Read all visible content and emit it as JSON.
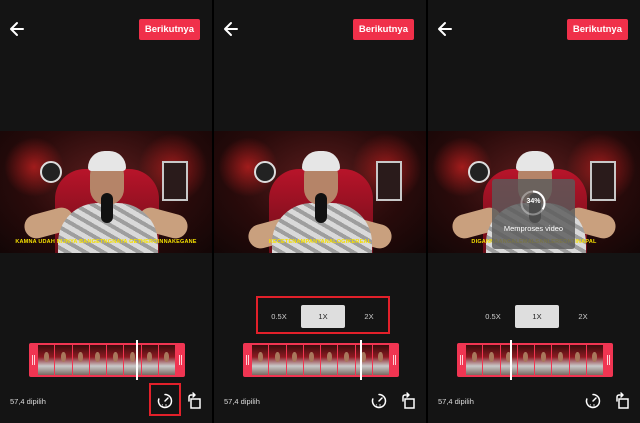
{
  "panels": [
    {
      "next_label": "Berikutnya",
      "subtitle": "KAMNA UDAH NIJNYA BANGETNGNAYA GETHEROINNAKEGANE",
      "selected_text": "57,4 dipilih",
      "speed_options": [],
      "highlight": "speed-icon"
    },
    {
      "next_label": "Berikutnya",
      "subtitle": "KECETENAMPANYANALOGIKEREAL",
      "selected_text": "57,4 dipilih",
      "speed_options": [
        "0.5X",
        "1X",
        "2X"
      ],
      "selected_speed": "1X",
      "highlight": "speed-options"
    },
    {
      "next_label": "Berikutnya",
      "subtitle": "DIGANNAANGALEMALSANLEREONTINAPAL",
      "selected_text": "57,4 dipilih",
      "speed_options": [
        "0.5X",
        "1X",
        "2X"
      ],
      "selected_speed": "1X",
      "processing": {
        "percent": 34,
        "percent_label": "34%",
        "label": "Memproses video"
      }
    }
  ],
  "colors": {
    "accent": "#f0304a",
    "highlight_red": "#e2202a",
    "selected_speed_bg": "#dedede"
  },
  "icons": [
    "back-arrow-icon",
    "speed-icon",
    "rotate-icon"
  ]
}
